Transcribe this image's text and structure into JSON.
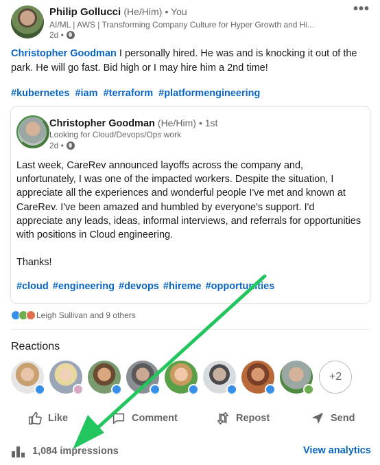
{
  "author": {
    "name": "Philip Gollucci",
    "pronouns": "(He/Him)",
    "connection": "• You",
    "headline": "AI/ML | AWS | Transforming Company Culture for Hyper Growth and Hi...",
    "time": "2d •"
  },
  "post": {
    "mention": "Christopher Goodman",
    "text": " I personally hired. He was and is knocking it out of the park. He will go fast. Bid high or I may hire him a 2nd time!",
    "hashtags": [
      "#kubernetes",
      "#iam",
      "#terraform",
      "#platformengineering"
    ]
  },
  "shared": {
    "name": "Christopher Goodman",
    "pronouns": "(He/Him)",
    "connection": "• 1st",
    "headline": "Looking for Cloud/Devops/Ops work",
    "time": "2d •",
    "paragraph1": "Last week, CareRev announced layoffs across the company and, unfortunately, I was one of the impacted workers. Despite the situation, I appreciate all the experiences and wonderful people I've met and known at CareRev. I've been amazed and humbled by everyone's support. I'd appreciate any leads, ideas, informal interviews, and referrals for opportunities with positions in Cloud engineering.",
    "paragraph2": "Thanks!",
    "hashtags": [
      "#cloud",
      "#engineering",
      "#devops",
      "#hireme",
      "#opportunities"
    ]
  },
  "social": {
    "summary": "Leigh Sullivan and 9 others"
  },
  "reactions": {
    "title": "Reactions",
    "more": "+2"
  },
  "actions": {
    "like": "Like",
    "comment": "Comment",
    "repost": "Repost",
    "send": "Send"
  },
  "footer": {
    "impressions": "1,084 impressions",
    "analytics": "View analytics"
  },
  "colors": {
    "accent": "#0a66c2",
    "arrow": "#22c55e"
  }
}
